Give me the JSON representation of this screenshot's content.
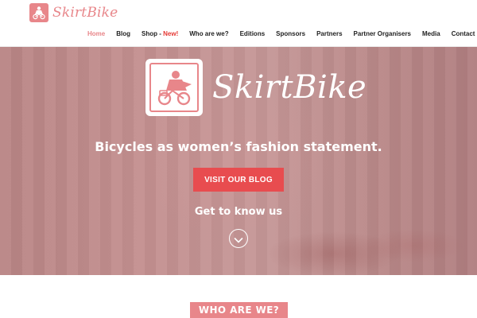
{
  "brand": {
    "name": "SkirtBike",
    "accent_color": "#e8868a",
    "logo_icon": "bicycle-girl-icon"
  },
  "nav": {
    "items": [
      {
        "label": "Home",
        "active": true
      },
      {
        "label": "Blog"
      },
      {
        "label": "Shop - ",
        "badge": "New!"
      },
      {
        "label": "Who are we?"
      },
      {
        "label": "Editions"
      },
      {
        "label": "Sponsors"
      },
      {
        "label": "Partners"
      },
      {
        "label": "Partner Organisers"
      },
      {
        "label": "Media"
      },
      {
        "label": "Contact"
      }
    ]
  },
  "hero": {
    "brand": "SkirtBike",
    "tagline": "Bicycles as women’s fashion statement.",
    "cta_label": "VISIT OUR BLOG",
    "cta_color": "#e84c4f",
    "know_label": "Get to know us",
    "scroll_icon": "chevron-down-circle-icon"
  },
  "section": {
    "heading": "WHO ARE WE?"
  }
}
